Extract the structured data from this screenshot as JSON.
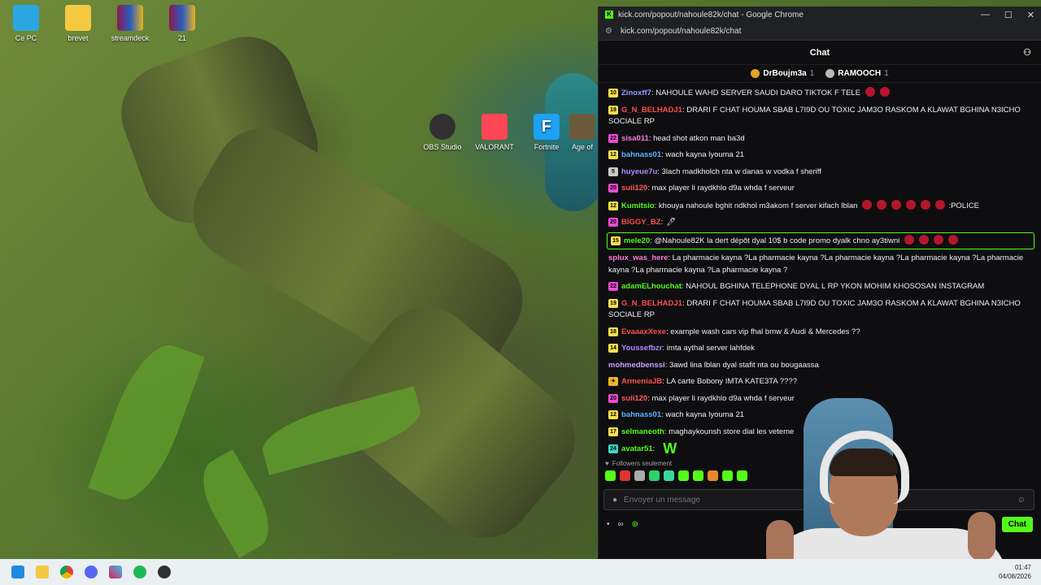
{
  "desktop": {
    "icons": [
      {
        "label": "Ce PC"
      },
      {
        "label": "brevet"
      },
      {
        "label": "streamdeck"
      },
      {
        "label": "21"
      },
      {
        "label": "OBS Studio"
      },
      {
        "label": "VALORANT"
      },
      {
        "label": "Fortnite"
      },
      {
        "label": "Age of"
      }
    ]
  },
  "window": {
    "title": "kick.com/popout/nahoule82k/chat - Google Chrome",
    "url": "kick.com/popout/nahoule82k/chat",
    "favicon_letter": "K",
    "controls": {
      "minimize": "—",
      "maximize": "☐",
      "close": "✕"
    }
  },
  "chat": {
    "header": "Chat",
    "leaderboard": [
      {
        "name": "DrBoujm3a",
        "count": "1",
        "medal_color": "#e0a526"
      },
      {
        "name": "RAMOOCH",
        "count": "1",
        "medal_color": "#b8b8b8"
      }
    ],
    "messages": [
      {
        "badge": "10",
        "badge_color": "#f7e14b",
        "user": "Zinoxff7",
        "user_color": "#8f9bff",
        "text": ": NAHOULE WAHD SERVER SAUDI DARO TIKTOK F TELE",
        "emotes": 2
      },
      {
        "badge": "19",
        "badge_color": "#f7e14b",
        "user": "G_N_BELHADJ1",
        "user_color": "#ff4d4d",
        "text": ": DRARI F CHAT HOUMA SBAB L7I9D OU TOXIC JAM3O RASKOM A KLAWAT BGHINA N3ICHO SOCIALE RP",
        "emotes": 0
      },
      {
        "badge": "22",
        "badge_color": "#e94bd2",
        "user": "sisa011",
        "user_color": "#ff7ad9",
        "text": ": head shot atkon man ba3d",
        "emotes": 0
      },
      {
        "badge": "12",
        "badge_color": "#f7e14b",
        "user": "bahnass01",
        "user_color": "#5ab4ff",
        "text": ": wach kayna lyouma 21",
        "emotes": 0
      },
      {
        "badge": "5",
        "badge_color": "#c9c9c9",
        "user": "huyeue7u",
        "user_color": "#b388ff",
        "text": ": 3lach madkholch nta w danas w vodka f sheriff",
        "emotes": 0
      },
      {
        "badge": "20",
        "badge_color": "#e94bd2",
        "user": "suii120",
        "user_color": "#ff5a5a",
        "text": ": max player li raydkhlo d9a whda f serveur",
        "emotes": 0
      },
      {
        "badge": "12",
        "badge_color": "#f7e14b",
        "user": "Kumitsio",
        "user_color": "#53fc18",
        "text": ": khouya nahoule bghit ndkhol m3akom f server kifach lblan",
        "emotes": 6,
        "suffix": ":POLICE"
      },
      {
        "badge": "20",
        "badge_color": "#e94bd2",
        "user": "BIGGY_BZ",
        "user_color": "#ff4d4d",
        "text": ":",
        "emotes": 0,
        "suffix": "🖊"
      },
      {
        "badge": "15",
        "badge_color": "#f7e14b",
        "user": "mele20",
        "user_color": "#53fc18",
        "text": ": @Nahoule82K la dert dépôt dyal 10$ b code promo dyalk chno ay3tiwni",
        "emotes": 4,
        "highlight": true
      },
      {
        "badge": "",
        "badge_color": "",
        "user": "splux_was_here",
        "user_color": "#ff7ad9",
        "text": ": La pharmacie kayna ?La pharmacie kayna ?La pharmacie kayna ?La pharmacie kayna ?La pharmacie kayna ?La pharmacie kayna ?La pharmacie kayna ?",
        "emotes": 0
      },
      {
        "badge": "22",
        "badge_color": "#e94bd2",
        "user": "adamELhouchat",
        "user_color": "#53fc18",
        "text": ": NAHOUL BGHINA TELEPHONE DYAL L RP YKON MOHIM KHOSOSAN INSTAGRAM",
        "emotes": 0
      },
      {
        "badge": "19",
        "badge_color": "#f7e14b",
        "user": "G_N_BELHADJ1",
        "user_color": "#ff4d4d",
        "text": ": DRARI F CHAT HOUMA SBAB L7I9D OU TOXIC JAM3O RASKOM A KLAWAT BGHINA N3ICHO SOCIALE RP",
        "emotes": 0
      },
      {
        "badge": "18",
        "badge_color": "#f7e14b",
        "user": "EvaaaxXexe",
        "user_color": "#ff4d4d",
        "text": ": example wash cars vip fhal bmw & Audi & Mercedes ??",
        "emotes": 0
      },
      {
        "badge": "14",
        "badge_color": "#f7e14b",
        "user": "Youssefbzr",
        "user_color": "#b388ff",
        "text": ": imta aythal server lahfdek",
        "emotes": 0
      },
      {
        "badge": "",
        "badge_color": "",
        "user": "mohmedbenssi",
        "user_color": "#c9a0ff",
        "text": ": 3awd lina lblan dyal stafit nta ou bougaassa",
        "emotes": 0
      },
      {
        "badge": "✦",
        "badge_color": "#f0b429",
        "user": "ArmeniaJB",
        "user_color": "#ff4d4d",
        "text": ": LA carte Bobony IMTA KATE3TA ????",
        "emotes": 0
      },
      {
        "badge": "20",
        "badge_color": "#e94bd2",
        "user": "suii120",
        "user_color": "#ff5a5a",
        "text": ": max player li raydkhlo d9a whda f serveur",
        "emotes": 0
      },
      {
        "badge": "12",
        "badge_color": "#f7e14b",
        "user": "bahnass01",
        "user_color": "#5ab4ff",
        "text": ": wach kayna lyouma 21",
        "emotes": 0
      },
      {
        "badge": "17",
        "badge_color": "#f7e14b",
        "user": "selmaneoth",
        "user_color": "#53fc18",
        "text": ": maghaykounsh store dial les veteme",
        "emotes": 0
      },
      {
        "badge": "24",
        "badge_color": "#3ad6c6",
        "user": "avatar51",
        "user_color": "#53fc18",
        "text": ":",
        "emotes": 0,
        "bigw": "W"
      }
    ],
    "followers_label": "Followers seulement",
    "input_placeholder": "Envoyer un message",
    "send_label": "Chat",
    "bottom_icons": [
      "•",
      "∞",
      "⊛"
    ]
  },
  "taskbar": {
    "time": "01:47",
    "date": "04/08/2026"
  },
  "colors": {
    "accent": "#53fc18",
    "chat_bg": "#0e0e10"
  }
}
